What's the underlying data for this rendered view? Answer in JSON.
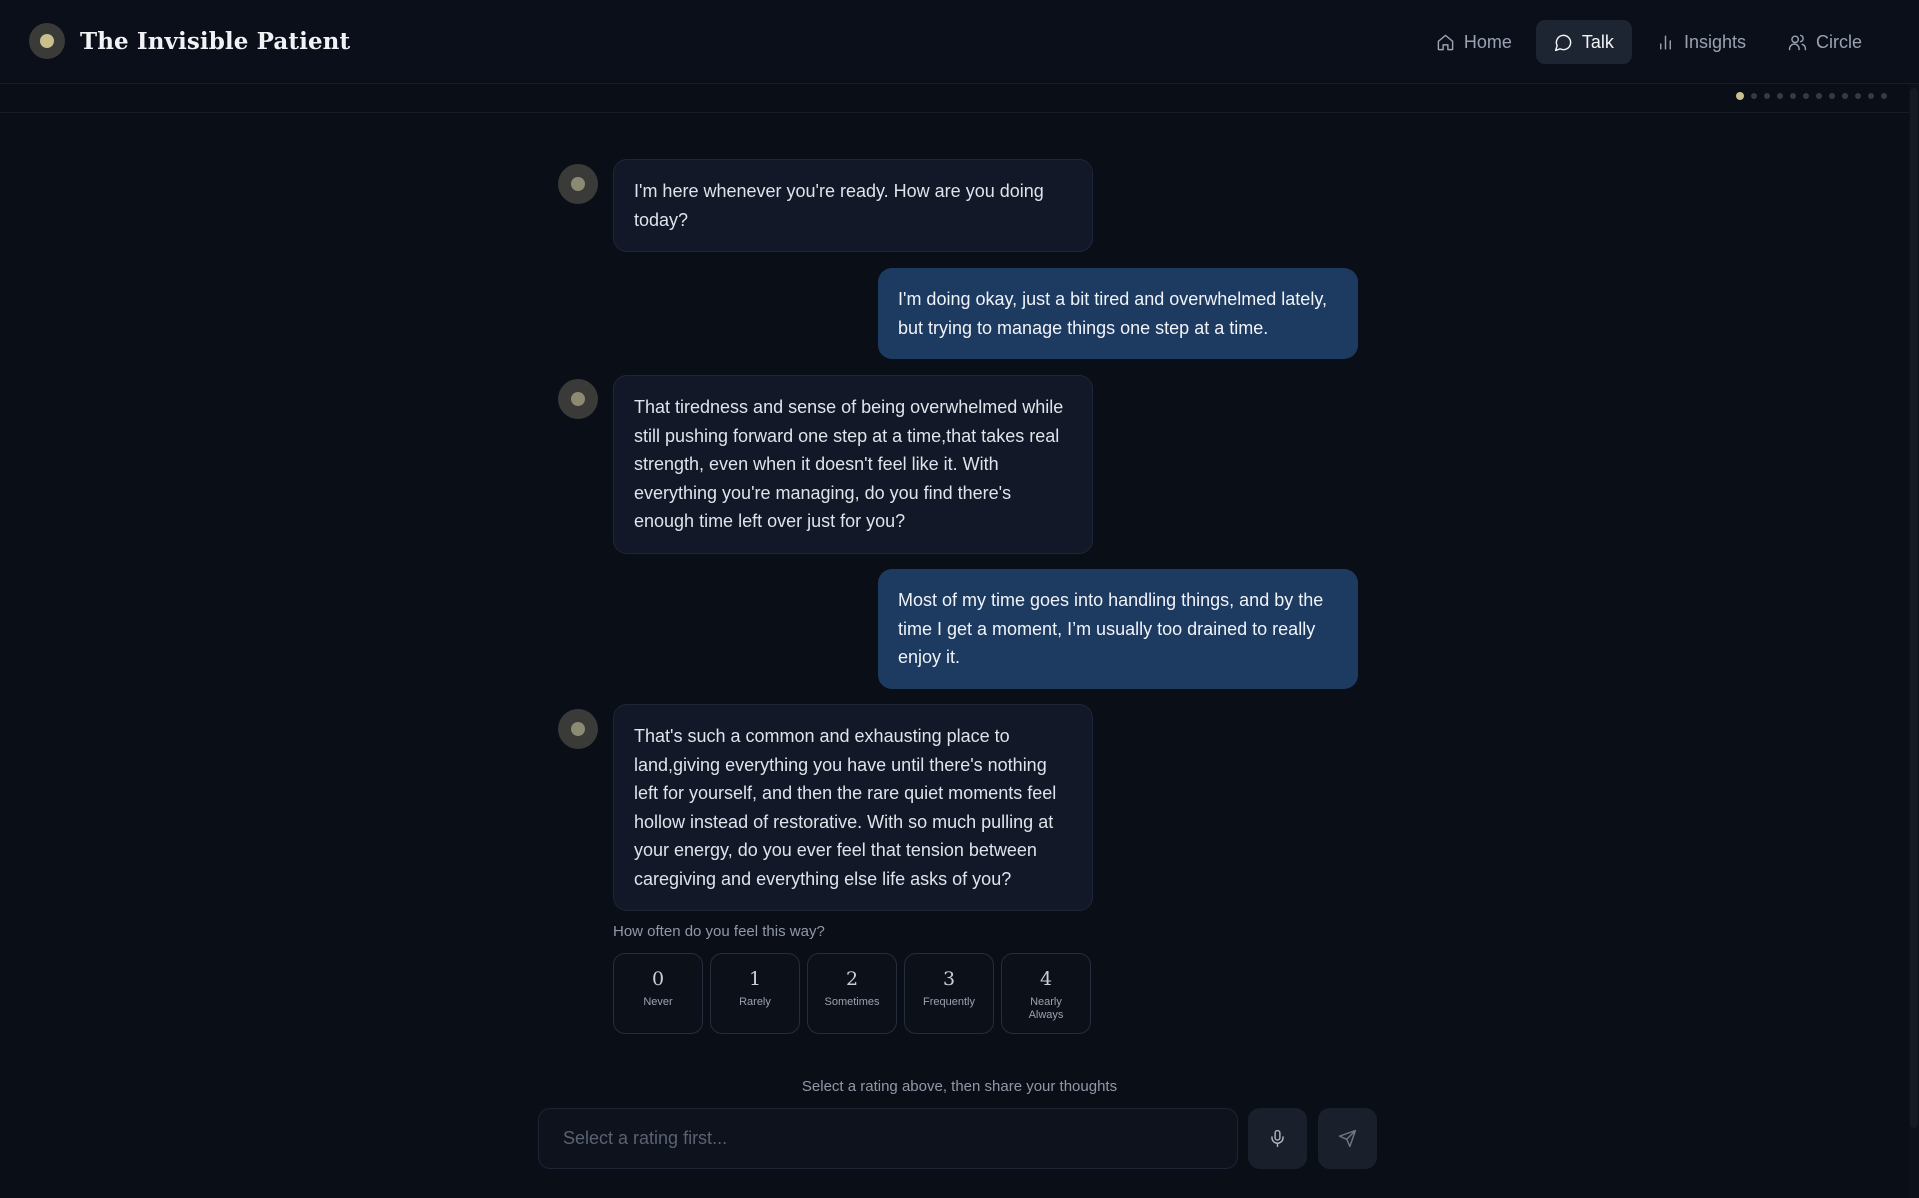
{
  "app": {
    "title": "The Invisible Patient",
    "logo_icon": "brand-orb-icon"
  },
  "nav": {
    "items": [
      {
        "label": "Home",
        "icon": "home-icon",
        "active": false
      },
      {
        "label": "Talk",
        "icon": "chat-bubble-icon",
        "active": true
      },
      {
        "label": "Insights",
        "icon": "bar-chart-icon",
        "active": false
      },
      {
        "label": "Circle",
        "icon": "users-icon",
        "active": false
      }
    ]
  },
  "progress": {
    "current_step": 1,
    "total_steps": 12
  },
  "messages": [
    {
      "role": "assistant",
      "text": "I'm here whenever you're ready. How are you doing today?"
    },
    {
      "role": "user",
      "text": "I'm doing okay, just a bit tired and overwhelmed lately, but trying to manage things one step at a time."
    },
    {
      "role": "assistant",
      "text": "That tiredness and sense of being overwhelmed while still pushing forward one step at a time,that takes real strength, even when it doesn't feel like it. With everything you're managing, do you find there's enough time left over just for you?"
    },
    {
      "role": "user",
      "text": "Most of my time goes into handling things, and by the time I get a moment, I’m usually too drained to really enjoy it."
    },
    {
      "role": "assistant",
      "text": "That's such a common and exhausting place to land,giving everything you have until there's nothing left for yourself, and then the rare quiet moments feel hollow instead of restorative. With so much pulling at your energy, do you ever feel that tension between caregiving and everything else life asks of you?"
    }
  ],
  "rating": {
    "prompt": "How often do you feel this way?",
    "options": [
      {
        "value": "0",
        "label": "Never"
      },
      {
        "value": "1",
        "label": "Rarely"
      },
      {
        "value": "2",
        "label": "Sometimes"
      },
      {
        "value": "3",
        "label": "Frequently"
      },
      {
        "value": "4",
        "label": "Nearly Always"
      }
    ]
  },
  "composer": {
    "hint": "Select a rating above, then share your thoughts",
    "placeholder": "Select a rating first...",
    "mic_icon": "microphone-icon",
    "send_icon": "send-icon"
  },
  "colors": {
    "background": "#0a0e17",
    "accent": "#c9c08e",
    "user_bubble": "#1d3a60",
    "assistant_bubble": "#121827"
  }
}
